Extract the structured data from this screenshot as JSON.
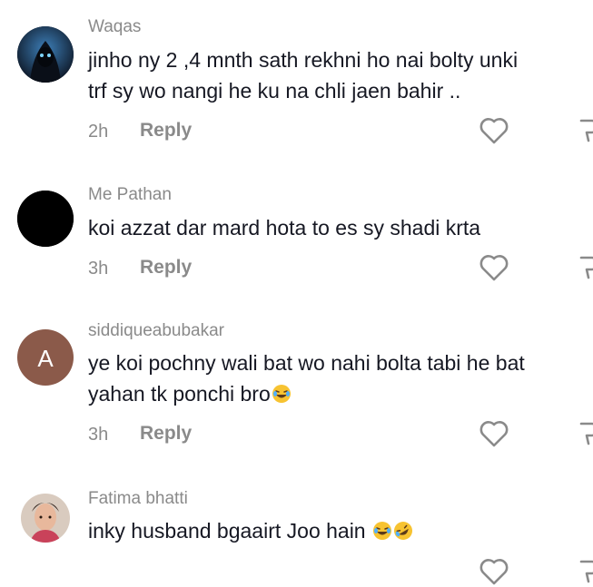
{
  "comments": [
    {
      "username": "Waqas",
      "text_lines": [
        "jinho ny 2 ,4 mnth sath rekhni ho nai bolty unki",
        "trf sy wo nangi he ku na chli jaen bahir .."
      ],
      "time": "2h",
      "reply_label": "Reply",
      "avatar": "hooded-figure-avatar"
    },
    {
      "username": "Me Pathan",
      "text_lines": [
        "koi azzat dar mard hota to es sy shadi krta"
      ],
      "time": "3h",
      "reply_label": "Reply",
      "avatar": "black-circle-avatar"
    },
    {
      "username": "siddiqueabubakar",
      "text_lines": [
        "ye koi pochny wali bat wo nahi bolta tabi he bat",
        "yahan tk ponchi bro"
      ],
      "time": "3h",
      "reply_label": "Reply",
      "avatar_letter": "A",
      "avatar_color": "#8b5a4a"
    },
    {
      "username": "Fatima bhatti",
      "text_lines": [
        "inky husband bgaairt Joo hain "
      ],
      "avatar": "photo-avatar"
    }
  ],
  "colors": {
    "username": "#8a8a8a",
    "text": "#161823",
    "background": "#ffffff"
  },
  "icons": [
    "heart-outline-icon",
    "dislike-icon",
    "laughing-emoji-icon",
    "rofl-emoji-icon"
  ]
}
